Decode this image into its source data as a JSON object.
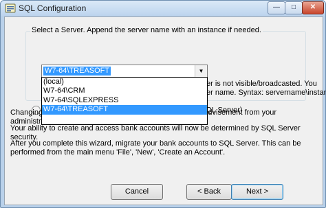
{
  "window": {
    "title": "SQL Configuration",
    "minimize_glyph": "—",
    "maximize_glyph": "□",
    "close_glyph": "✕"
  },
  "server_group": {
    "legend": "Select a Server.  Append the server name with an instance if needed.",
    "combo_value": "W7-64\\TREASOFT",
    "combo_arrow": "▼",
    "options": [
      "(local)",
      "W7-64\\CRM",
      "W7-64\\SQLEXPRESS",
      "W7-64\\TREASOFT"
    ],
    "selected_index": 3,
    "note_line1": "er is not visible/broadcasted.  You",
    "note_line2": "er name.  Syntax: servername\\instance",
    "check_line": "Check SQL EXPRESS (Use unchecked if Full SQL Server)"
  },
  "paragraphs": {
    "p1": "Changing your database should only be performed under advisement from your administrator.",
    "p2": "Your ability to create and access bank accounts will now be determined by SQL Server security.",
    "p3": "After you complete this wizard, migrate your bank accounts to SQL Server.  This can be performed from the main menu 'File', 'New', 'Create an Account'."
  },
  "buttons": {
    "cancel": "Cancel",
    "back": "< Back",
    "next": "Next >"
  },
  "colors": {
    "selection": "#3399ff",
    "dialog_bg": "#f0f0f0",
    "title_bar": "#bcd4ee"
  }
}
